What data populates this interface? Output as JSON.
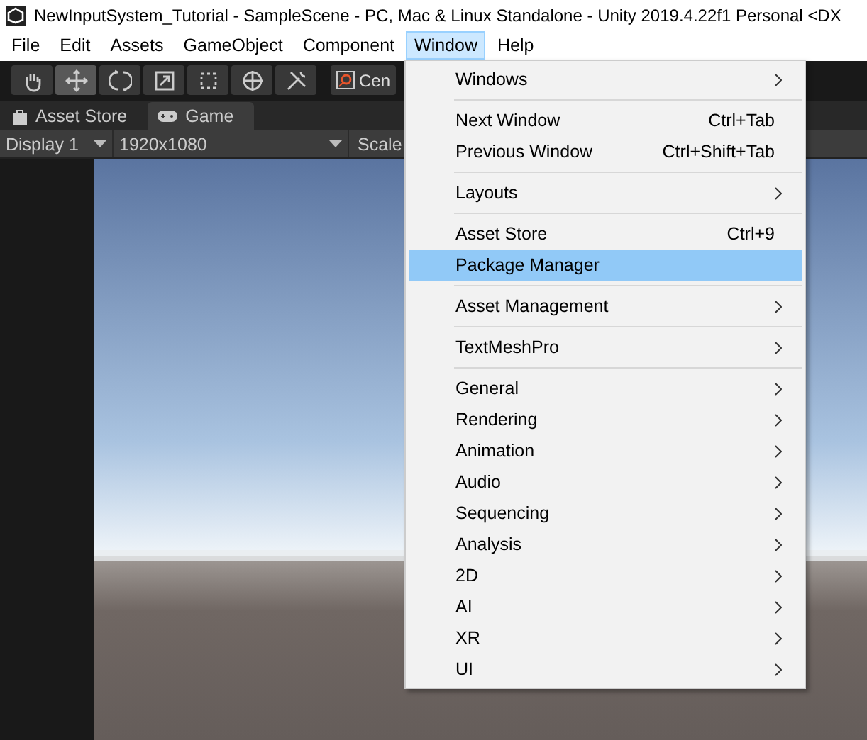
{
  "window": {
    "title": "NewInputSystem_Tutorial - SampleScene - PC, Mac & Linux Standalone - Unity 2019.4.22f1 Personal <DX"
  },
  "menubar": [
    {
      "label": "File",
      "selected": false
    },
    {
      "label": "Edit",
      "selected": false
    },
    {
      "label": "Assets",
      "selected": false
    },
    {
      "label": "GameObject",
      "selected": false
    },
    {
      "label": "Component",
      "selected": false
    },
    {
      "label": "Window",
      "selected": true
    },
    {
      "label": "Help",
      "selected": false
    }
  ],
  "toolbar": {
    "tools": [
      {
        "kind": "hand",
        "selected": false
      },
      {
        "kind": "move",
        "selected": true
      },
      {
        "kind": "rotate",
        "selected": false
      },
      {
        "kind": "scale",
        "selected": false
      },
      {
        "kind": "rect",
        "selected": false
      },
      {
        "kind": "transform",
        "selected": false
      },
      {
        "kind": "custom",
        "selected": false
      }
    ],
    "pivot_button": "Cen"
  },
  "tabs": [
    {
      "label": "Asset Store",
      "kind": "store",
      "selected": false
    },
    {
      "label": "Game",
      "kind": "game",
      "selected": true
    }
  ],
  "game_toolbar": {
    "display": "Display 1",
    "resolution": "1920x1080",
    "scale": "Scale"
  },
  "window_menu": {
    "groups": [
      [
        {
          "label": "Windows",
          "submenu": true,
          "selected": false
        }
      ],
      [
        {
          "label": "Next Window",
          "shortcut": "Ctrl+Tab",
          "submenu": false,
          "selected": false
        },
        {
          "label": "Previous Window",
          "shortcut": "Ctrl+Shift+Tab",
          "submenu": false,
          "selected": false
        }
      ],
      [
        {
          "label": "Layouts",
          "submenu": true,
          "selected": false
        }
      ],
      [
        {
          "label": "Asset Store",
          "shortcut": "Ctrl+9",
          "submenu": false,
          "selected": false
        },
        {
          "label": "Package Manager",
          "submenu": false,
          "selected": true
        }
      ],
      [
        {
          "label": "Asset Management",
          "submenu": true,
          "selected": false
        }
      ],
      [
        {
          "label": "TextMeshPro",
          "submenu": true,
          "selected": false
        }
      ],
      [
        {
          "label": "General",
          "submenu": true,
          "selected": false
        },
        {
          "label": "Rendering",
          "submenu": true,
          "selected": false
        },
        {
          "label": "Animation",
          "submenu": true,
          "selected": false
        },
        {
          "label": "Audio",
          "submenu": true,
          "selected": false
        },
        {
          "label": "Sequencing",
          "submenu": true,
          "selected": false
        },
        {
          "label": "Analysis",
          "submenu": true,
          "selected": false
        },
        {
          "label": "2D",
          "submenu": true,
          "selected": false
        },
        {
          "label": "AI",
          "submenu": true,
          "selected": false
        },
        {
          "label": "XR",
          "submenu": true,
          "selected": false
        },
        {
          "label": "UI",
          "submenu": true,
          "selected": false
        }
      ]
    ]
  }
}
